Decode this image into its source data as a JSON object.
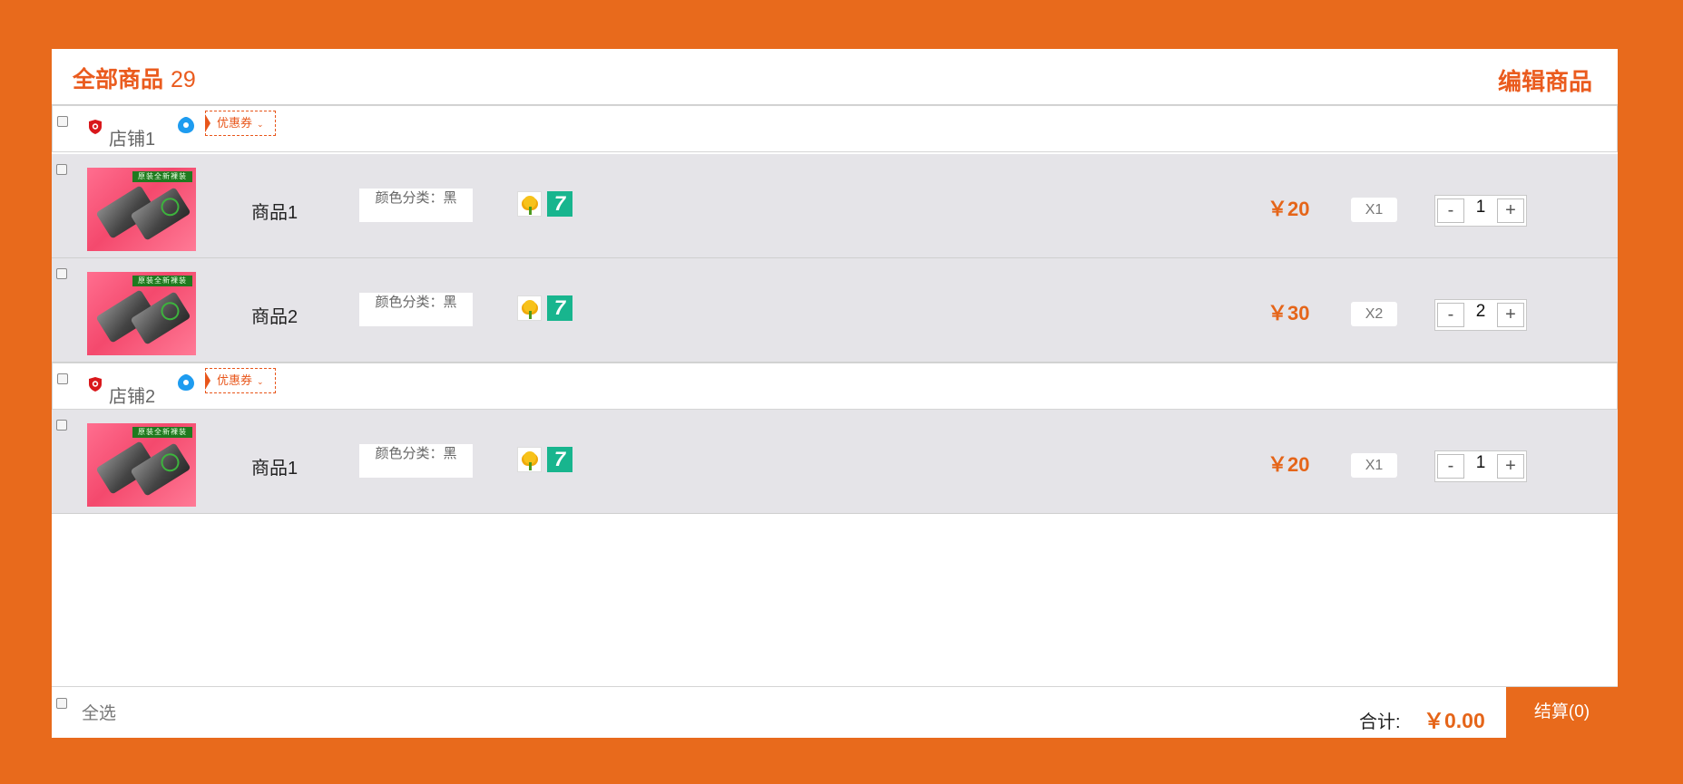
{
  "header": {
    "title": "全部商品",
    "count": "29",
    "edit_label": "编辑商品"
  },
  "colors": {
    "accent": "#e86a1c",
    "price": "#e56519",
    "item_bg": "#e5e4e8"
  },
  "shops": [
    {
      "name": "店铺1",
      "icon": "shield-icon",
      "badge_icon": "drop-icon",
      "coupon_label": "优惠券",
      "items": [
        {
          "name": "商品1",
          "spec": "颜色分类：黑",
          "price": "￥20",
          "qty_tag": "X1",
          "quantity": "1"
        },
        {
          "name": "商品2",
          "spec": "颜色分类：黑",
          "price": "￥30",
          "qty_tag": "X2",
          "quantity": "2"
        }
      ]
    },
    {
      "name": "店铺2",
      "icon": "shield-icon",
      "badge_icon": "drop-icon",
      "coupon_label": "优惠券",
      "items": [
        {
          "name": "商品1",
          "spec": "颜色分类：黑",
          "price": "￥20",
          "qty_tag": "X1",
          "quantity": "1"
        }
      ]
    }
  ],
  "product_image": {
    "banner_text": "原装全新裸装"
  },
  "badges": {
    "seven_text": "7"
  },
  "stepper": {
    "minus": "-",
    "plus": "+"
  },
  "footer": {
    "select_all_label": "全选",
    "total_label": "合计:",
    "total_value": "￥0.00",
    "checkout_label": "结算(0)"
  }
}
